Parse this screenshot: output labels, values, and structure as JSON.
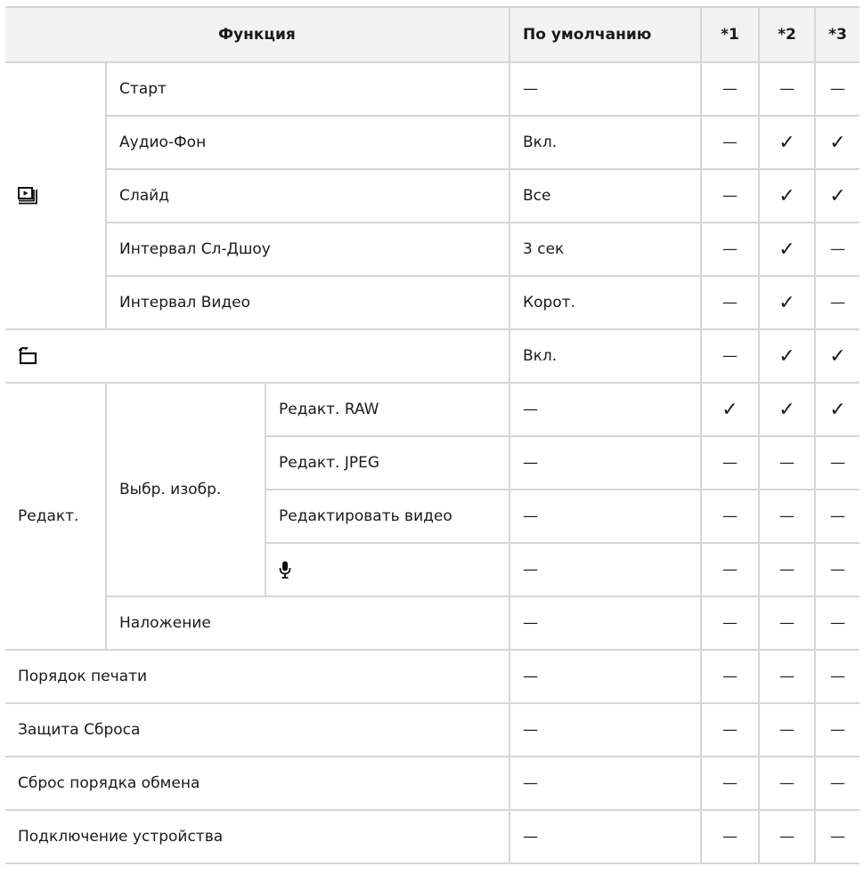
{
  "headers": {
    "function": "Функция",
    "default": "По умолчанию",
    "c1": "*1",
    "c2": "*2",
    "c3": "*3"
  },
  "sections": {
    "slideshow": {
      "icon": "slideshow-icon"
    },
    "rotate": {
      "icon": "rotate-icon"
    },
    "edit": {
      "label": "Редакт.",
      "select_image": "Выбр. изобр."
    },
    "mic": {
      "icon": "microphone-icon"
    }
  },
  "rows": [
    {
      "label": "Старт",
      "default": "—",
      "c1": "—",
      "c2": "—",
      "c3": "—"
    },
    {
      "label": "Аудио-Фон",
      "default": "Вкл.",
      "c1": "—",
      "c2": "✓",
      "c3": "✓"
    },
    {
      "label": "Слайд",
      "default": "Все",
      "c1": "—",
      "c2": "✓",
      "c3": "✓"
    },
    {
      "label": "Интервал Сл-Дшоу",
      "default": "3 сек",
      "c1": "—",
      "c2": "✓",
      "c3": "—"
    },
    {
      "label": "Интервал Видео",
      "default": "Корот.",
      "c1": "—",
      "c2": "✓",
      "c3": "—"
    },
    {
      "label": "",
      "default": "Вкл.",
      "c1": "—",
      "c2": "✓",
      "c3": "✓"
    },
    {
      "label": "Редакт. RAW",
      "default": "—",
      "c1": "✓",
      "c2": "✓",
      "c3": "✓"
    },
    {
      "label": "Редакт. JPEG",
      "default": "—",
      "c1": "—",
      "c2": "—",
      "c3": "—"
    },
    {
      "label": "Редактировать видео",
      "default": "—",
      "c1": "—",
      "c2": "—",
      "c3": "—"
    },
    {
      "label": "",
      "default": "—",
      "c1": "—",
      "c2": "—",
      "c3": "—"
    },
    {
      "label": "Наложение",
      "default": "—",
      "c1": "—",
      "c2": "—",
      "c3": "—"
    },
    {
      "label": "Порядок печати",
      "default": "—",
      "c1": "—",
      "c2": "—",
      "c3": "—"
    },
    {
      "label": "Защита Сброса",
      "default": "—",
      "c1": "—",
      "c2": "—",
      "c3": "—"
    },
    {
      "label": "Сброс порядка обмена",
      "default": "—",
      "c1": "—",
      "c2": "—",
      "c3": "—"
    },
    {
      "label": "Подключение устройства",
      "default": "—",
      "c1": "—",
      "c2": "—",
      "c3": "—"
    }
  ]
}
